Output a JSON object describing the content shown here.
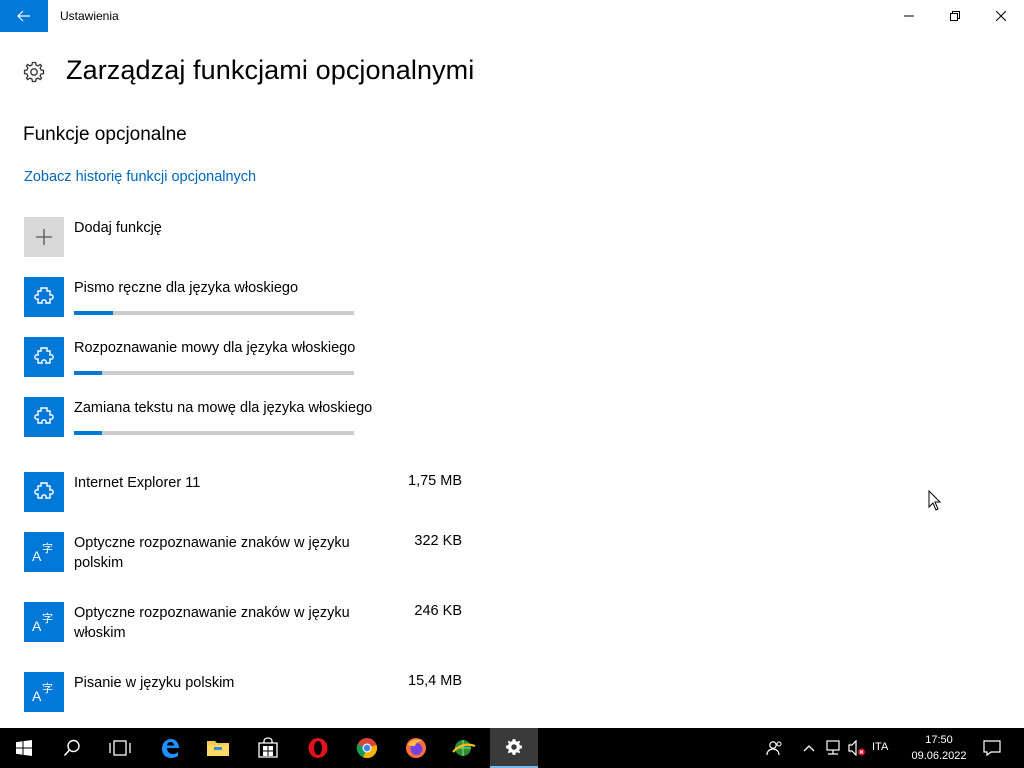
{
  "window": {
    "app_title": "Ustawienia"
  },
  "page": {
    "title": "Zarządzaj funkcjami opcjonalnymi",
    "section_title": "Funkcje opcjonalne",
    "history_link": "Zobacz historię funkcji opcjonalnych",
    "add_feature_label": "Dodaj funkcję"
  },
  "installing": [
    {
      "name": "Pismo ręczne dla języka włoskiego",
      "icon": "puzzle-icon",
      "progress": 0.14
    },
    {
      "name": "Rozpoznawanie mowy dla języka włoskiego",
      "icon": "puzzle-icon",
      "progress": 0.1
    },
    {
      "name": "Zamiana tekstu na mowę dla języka włoskiego",
      "icon": "puzzle-icon",
      "progress": 0.1
    }
  ],
  "installed": [
    {
      "name": "Internet Explorer 11",
      "size": "1,75 MB",
      "icon": "puzzle-icon"
    },
    {
      "name": "Optyczne rozpoznawanie znaków w języku polskim",
      "size": "322 KB",
      "icon": "language-icon"
    },
    {
      "name": "Optyczne rozpoznawanie znaków w języku włoskim",
      "size": "246 KB",
      "icon": "language-icon"
    },
    {
      "name": "Pisanie w języku polskim",
      "size": "15,4 MB",
      "icon": "language-icon"
    }
  ],
  "taskbar": {
    "apps": [
      "start-icon",
      "search-icon",
      "task-view-icon",
      "edge-icon",
      "file-explorer-icon",
      "store-icon",
      "opera-icon",
      "chrome-icon",
      "firefox-icon",
      "network-app-icon",
      "settings-icon"
    ],
    "tray": {
      "language": "ITA",
      "time": "17:50",
      "date": "09.06.2022"
    }
  },
  "colors": {
    "accent": "#0078d7",
    "link": "#0067b8",
    "progress_track": "#cccccc"
  }
}
